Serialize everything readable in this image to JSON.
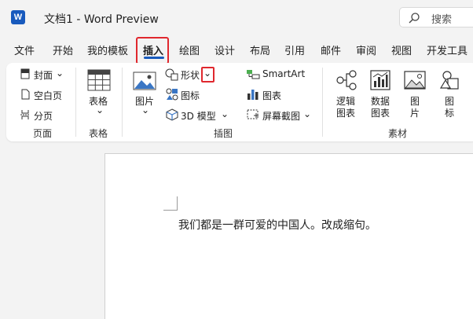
{
  "app": {
    "title": "文档1  -  Word Preview",
    "logo_letter": "W"
  },
  "search": {
    "label": "搜索"
  },
  "tabs": [
    "文件",
    "开始",
    "我的模板",
    "插入",
    "绘图",
    "设计",
    "布局",
    "引用",
    "邮件",
    "审阅",
    "视图",
    "开发工具"
  ],
  "active_tab": "插入",
  "ribbon": {
    "pages": {
      "cover": "封面",
      "blank": "空白页",
      "break": "分页",
      "group": "页面"
    },
    "tables": {
      "table": "表格",
      "group": "表格"
    },
    "illustrations": {
      "pictures": "图片",
      "shapes": "形状",
      "icons": "图标",
      "models3d": "3D 模型",
      "smartart": "SmartArt",
      "chart": "图表",
      "screenshot": "屏幕截图",
      "group": "插图"
    },
    "materials": {
      "logic_1": "逻辑",
      "logic_2": "图表",
      "data_1": "数据",
      "data_2": "图表",
      "pic_1": "图",
      "pic_2": "片",
      "icon_1": "图",
      "icon_2": "标",
      "group": "素材"
    }
  },
  "document": {
    "text": "我们都是一群可爱的中国人。改成缩句。"
  },
  "colors": {
    "accent": "#185abd",
    "highlight": "#e0282e"
  }
}
